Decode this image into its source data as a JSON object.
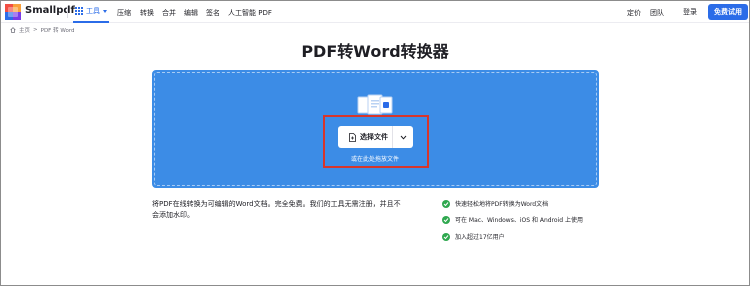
{
  "header": {
    "brand": "Smallpdf",
    "tools_label": "工具",
    "nav": [
      "压缩",
      "转换",
      "合并",
      "编辑",
      "签名",
      "人工智能 PDF"
    ],
    "pricing": "定价",
    "team": "团队",
    "login": "登录",
    "free_trial": "免费试用"
  },
  "breadcrumb": {
    "home": "主页",
    "separator": ">",
    "current": "PDF 转 Word"
  },
  "page_title": "PDF转Word转换器",
  "upload": {
    "choose_file": "选择文件",
    "or_drop": "或在此处拖放文件"
  },
  "description": "将PDF在线转换为可编辑的Word文档。完全免费。我们的工具无需注册，并且不会添加水印。",
  "features": [
    "快速轻松地将PDF转换为Word文档",
    "可在 Mac、Windows、iOS 和 Android 上使用",
    "加入超过17亿用户"
  ],
  "colors": {
    "accent": "#2b6ce8",
    "drop_area": "#3c8ce6",
    "highlight_box": "#d8352a",
    "check": "#2fa84f"
  },
  "icons": [
    "smallpdf-logo",
    "grid-icon",
    "chevron-down-icon",
    "home-icon",
    "documents-icon",
    "file-icon",
    "check-icon"
  ]
}
